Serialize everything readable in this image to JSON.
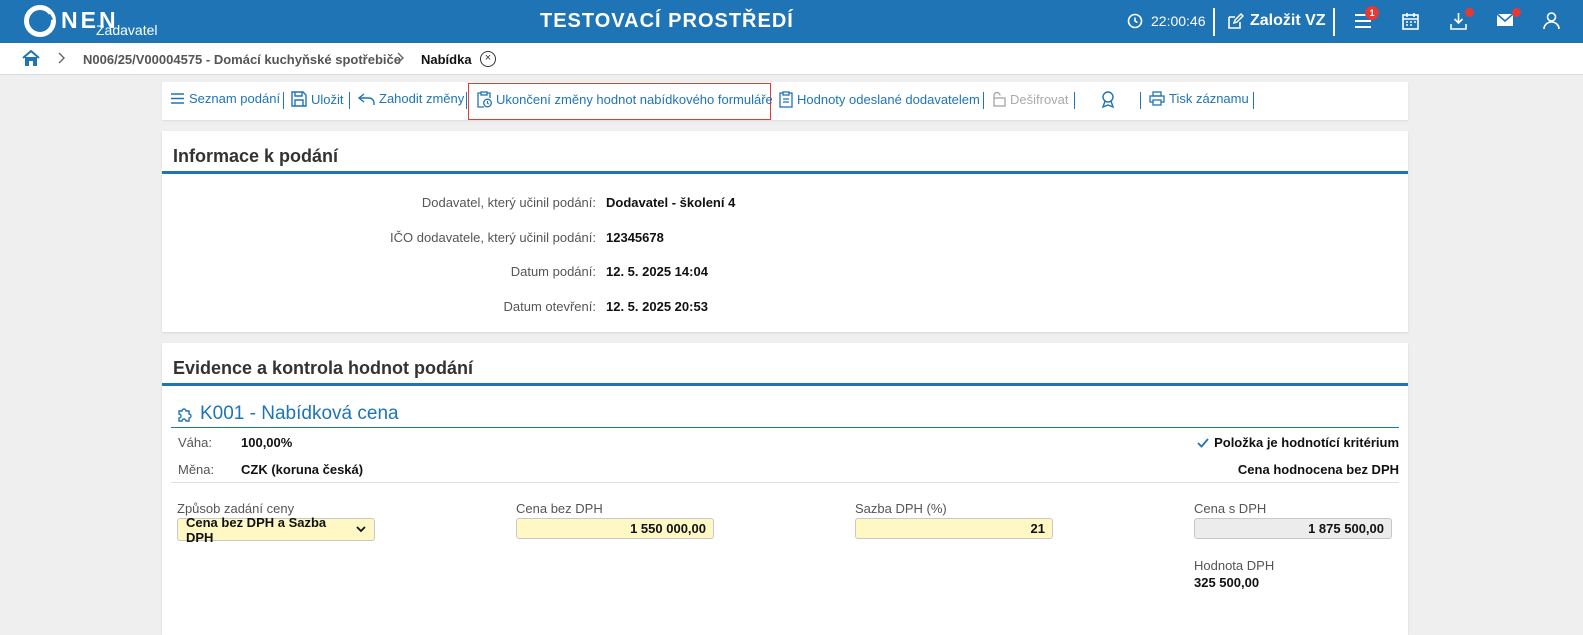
{
  "topbar": {
    "logo_text": "NEN",
    "logo_sub": "Zadavatel",
    "env_title": "TESTOVACÍ PROSTŘEDÍ",
    "time": "22:00:46",
    "create_vz": "Založit VZ",
    "menu_badge": "1",
    "bg_color": "#1f74b6",
    "badge_color": "#e53935"
  },
  "breadcrumb": {
    "items": [
      "N006/25/V00004575 - Domácí kuchyňské spotřebiče",
      "Nabídka"
    ]
  },
  "toolbar": {
    "items": [
      "Seznam podání",
      "Uložit",
      "Zahodit změny",
      "Ukončení změny hodnot nabídkového formuláře",
      "Hodnoty odeslané dodavatelem",
      "Dešifrovat",
      "Tisk záznamu"
    ]
  },
  "info": {
    "title": "Informace k podání",
    "rows": [
      {
        "label": "Dodavatel, který učinil podání:",
        "value": "Dodavatel - školení 4"
      },
      {
        "label": "IČO dodavatele, který učinil podání:",
        "value": "12345678"
      },
      {
        "label": "Datum podání:",
        "value": "12. 5. 2025 14:04"
      },
      {
        "label": "Datum otevření:",
        "value": "12. 5. 2025 20:53"
      }
    ]
  },
  "evidence": {
    "title": "Evidence a kontrola hodnot podání",
    "criterion": {
      "title": "K001 - Nabídková cena",
      "weight_label": "Váha:",
      "weight_value": "100,00%",
      "currency_label": "Měna:",
      "currency_value": "CZK (koruna česká)",
      "is_criterion": "Položka je hodnotící kritérium",
      "evaluated": "Cena hodnocena bez DPH"
    },
    "fields": {
      "mode_label": "Způsob zadání ceny",
      "mode_value": "Cena bez DPH a Sazba DPH",
      "price_label": "Cena bez DPH",
      "price_value": "1 550 000,00",
      "vat_rate_label": "Sazba DPH (%)",
      "vat_rate_value": "21",
      "price_vat_label": "Cena s DPH",
      "price_vat_value": "1 875 500,00",
      "vat_label": "Hodnota DPH",
      "vat_value": "325 500,00"
    }
  }
}
